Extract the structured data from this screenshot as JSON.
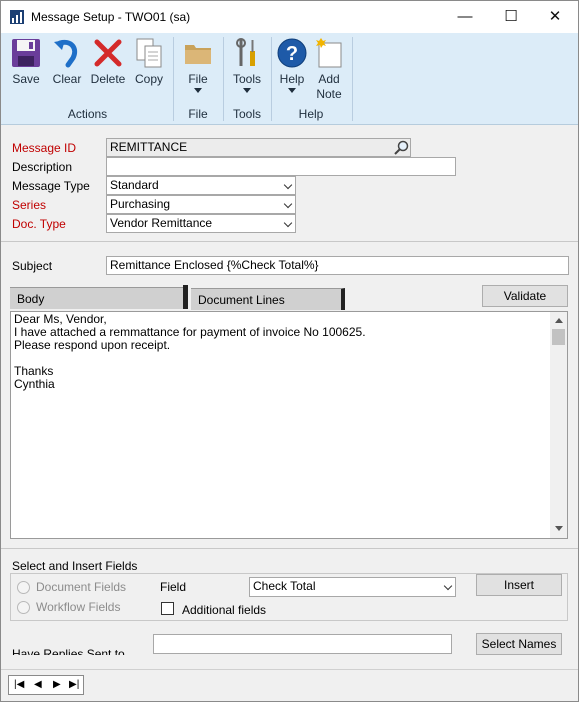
{
  "window": {
    "title": "Message Setup  -  TWO01 (sa)",
    "controls": {
      "minimize": "—",
      "maximize": "☐",
      "close": "✕"
    }
  },
  "ribbon": {
    "actions": {
      "save": "Save",
      "clear": "Clear",
      "delete": "Delete",
      "copy": "Copy",
      "group_label": "Actions"
    },
    "file": {
      "button": "File",
      "group_label": "File"
    },
    "tools": {
      "button": "Tools",
      "group_label": "Tools"
    },
    "help": {
      "button": "Help",
      "add_note_line1": "Add",
      "add_note_line2": "Note",
      "group_label": "Help"
    }
  },
  "form": {
    "message_id": {
      "label": "Message ID",
      "value": "REMITTANCE"
    },
    "description": {
      "label": "Description",
      "value": ""
    },
    "message_type": {
      "label": "Message Type",
      "value": "Standard"
    },
    "series": {
      "label": "Series",
      "value": "Purchasing"
    },
    "doc_type": {
      "label": "Doc. Type",
      "value": "Vendor Remittance"
    },
    "subject": {
      "label": "Subject",
      "value": "Remittance Enclosed {%Check Total%}"
    }
  },
  "tabs": {
    "body": "Body",
    "document_lines": "Document Lines"
  },
  "validate_button": "Validate",
  "message_body": {
    "lines": [
      "Dear Ms, Vendor,",
      "I have attached a remmattance for payment of invoice No 100625.",
      "Please respond upon receipt.",
      "",
      "Thanks",
      "Cynthia"
    ]
  },
  "insert": {
    "section_label": "Select and Insert Fields",
    "document_fields": "Document Fields",
    "workflow_fields": "Workflow Fields",
    "field_label": "Field",
    "field_value": "Check Total",
    "insert_button": "Insert",
    "additional_fields": "Additional fields"
  },
  "replies": {
    "label": "Have Replies Sent to",
    "value": "",
    "select_names_button": "Select Names"
  },
  "colors": {
    "required_label": "#c00000",
    "ribbon_bg": "#dcecf8",
    "help_blue": "#1e5aa8"
  }
}
